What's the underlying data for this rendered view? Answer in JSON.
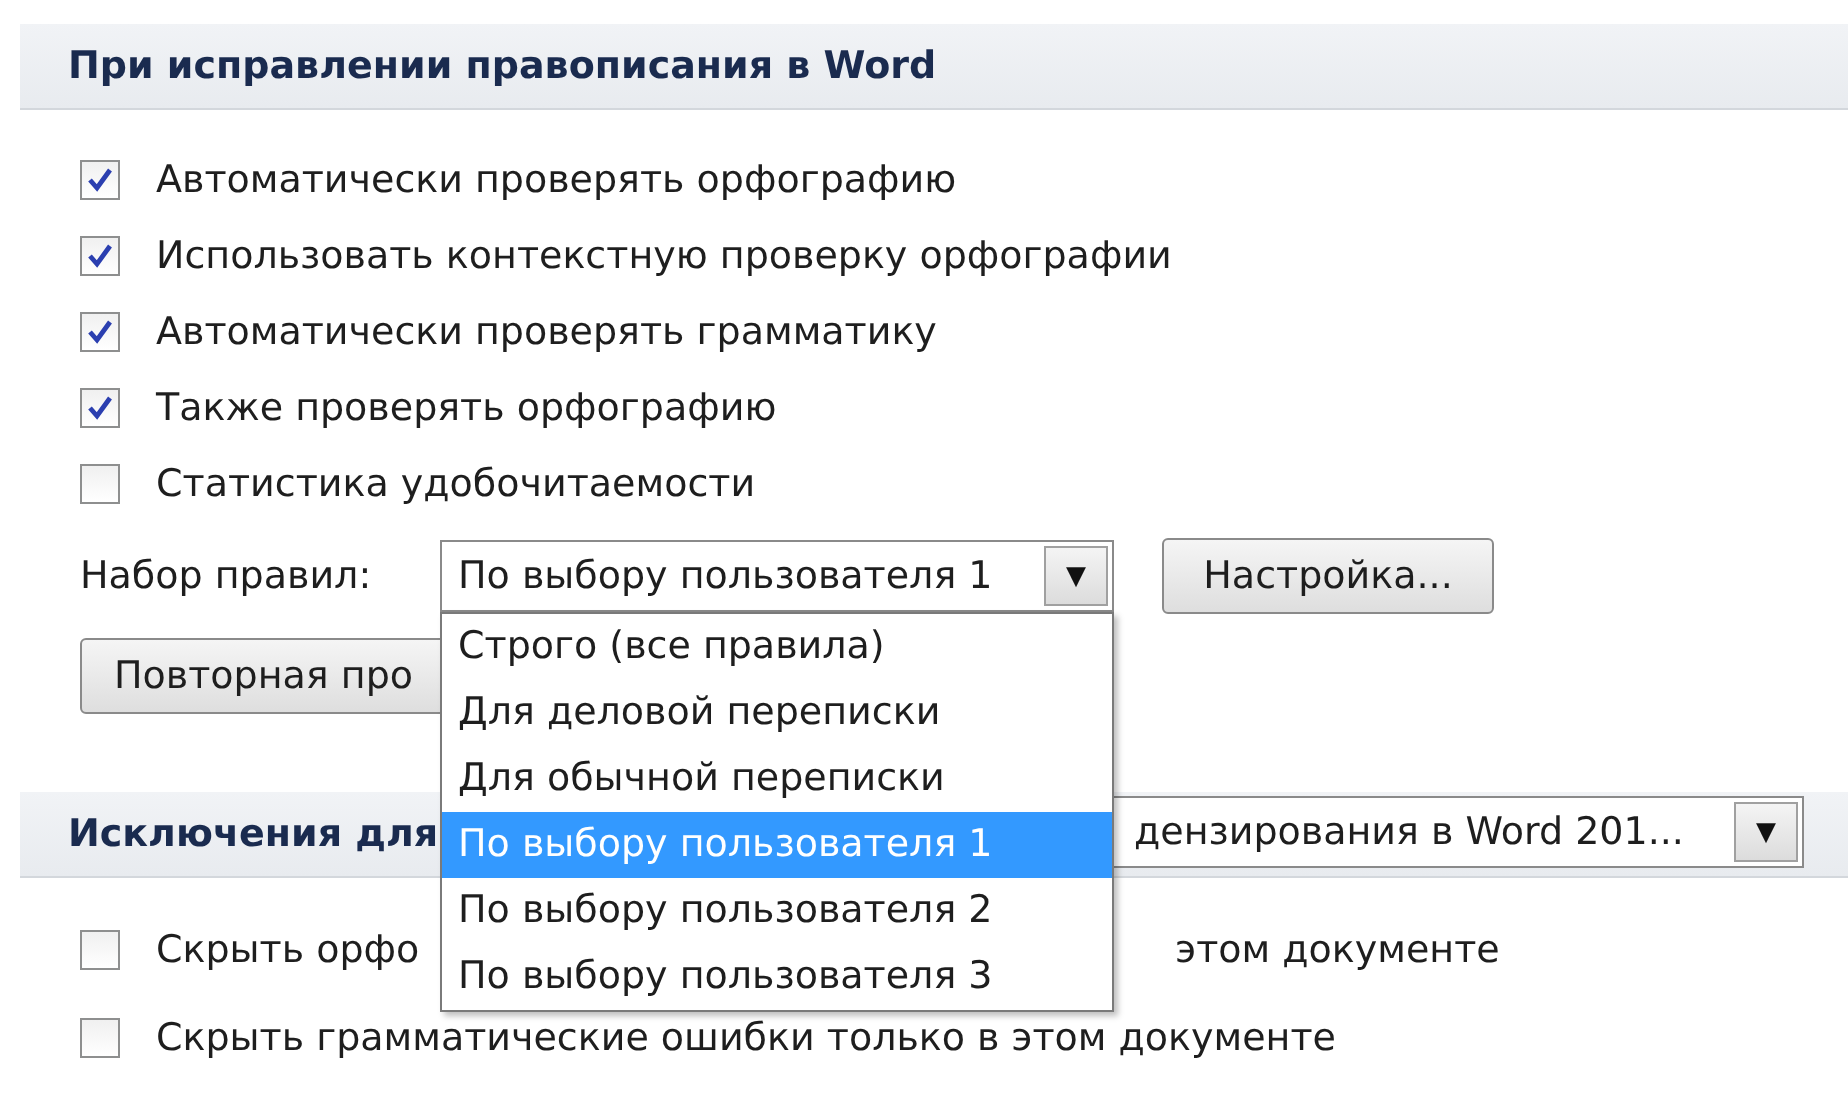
{
  "section_1": {
    "title": "При исправлении правописания в Word"
  },
  "options": [
    {
      "label": "Автоматически проверять орфографию",
      "checked": true
    },
    {
      "label": "Использовать контекстную проверку орфографии",
      "checked": true
    },
    {
      "label": "Автоматически проверять грамматику",
      "checked": true
    },
    {
      "label": "Также проверять орфографию",
      "checked": true
    },
    {
      "label": "Статистика удобочитаемости",
      "checked": false
    }
  ],
  "rule_set": {
    "label": "Набор правил:",
    "value": "По выбору пользователя 1",
    "arrow": "▼"
  },
  "settings_button": "Настройка...",
  "recheck_button": "Повторная про",
  "rule_set_list": [
    {
      "label": "Строго (все правила)",
      "selected": false
    },
    {
      "label": "Для деловой переписки",
      "selected": false
    },
    {
      "label": "Для обычной переписки",
      "selected": false
    },
    {
      "label": "По выбору пользователя 1",
      "selected": true
    },
    {
      "label": "По выбору пользователя 2",
      "selected": false
    },
    {
      "label": "По выбору пользователя 3",
      "selected": false
    }
  ],
  "section_2": {
    "title": "Исключения для",
    "document_value": "дензирования в Word 201...",
    "arrow": "▼"
  },
  "exceptions": [
    {
      "label": "Скрыть орфо",
      "label_end": "этом документе",
      "checked": false
    },
    {
      "label": "Скрыть грамматические ошибки только в этом документе",
      "checked": false
    }
  ]
}
